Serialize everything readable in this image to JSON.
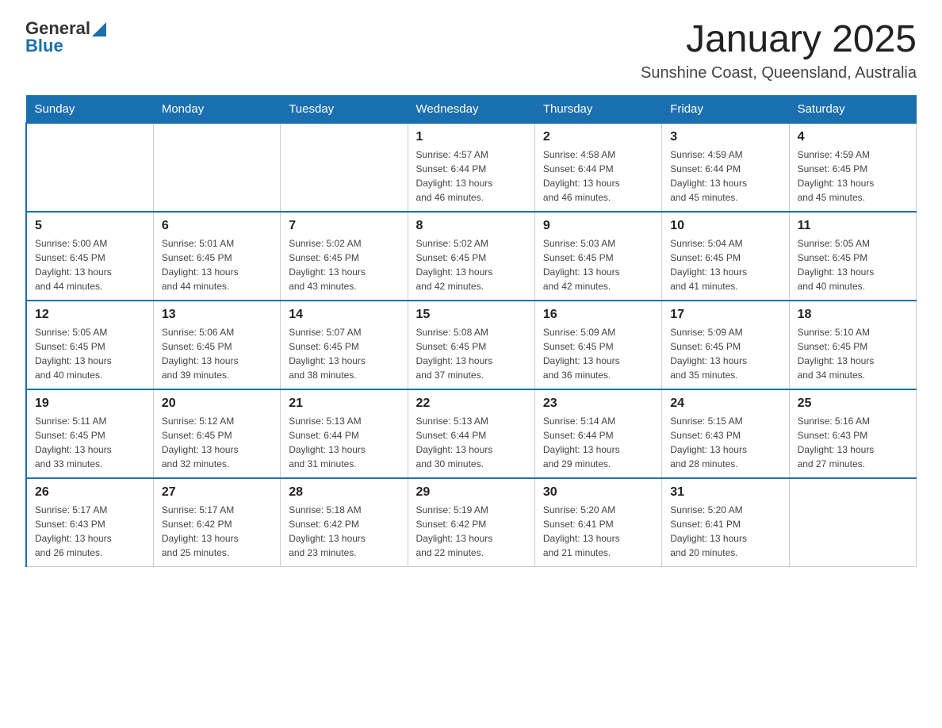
{
  "logo": {
    "text_general": "General",
    "text_blue": "Blue"
  },
  "header": {
    "title": "January 2025",
    "subtitle": "Sunshine Coast, Queensland, Australia"
  },
  "days_of_week": [
    "Sunday",
    "Monday",
    "Tuesday",
    "Wednesday",
    "Thursday",
    "Friday",
    "Saturday"
  ],
  "weeks": [
    [
      {
        "day": "",
        "info": ""
      },
      {
        "day": "",
        "info": ""
      },
      {
        "day": "",
        "info": ""
      },
      {
        "day": "1",
        "info": "Sunrise: 4:57 AM\nSunset: 6:44 PM\nDaylight: 13 hours\nand 46 minutes."
      },
      {
        "day": "2",
        "info": "Sunrise: 4:58 AM\nSunset: 6:44 PM\nDaylight: 13 hours\nand 46 minutes."
      },
      {
        "day": "3",
        "info": "Sunrise: 4:59 AM\nSunset: 6:44 PM\nDaylight: 13 hours\nand 45 minutes."
      },
      {
        "day": "4",
        "info": "Sunrise: 4:59 AM\nSunset: 6:45 PM\nDaylight: 13 hours\nand 45 minutes."
      }
    ],
    [
      {
        "day": "5",
        "info": "Sunrise: 5:00 AM\nSunset: 6:45 PM\nDaylight: 13 hours\nand 44 minutes."
      },
      {
        "day": "6",
        "info": "Sunrise: 5:01 AM\nSunset: 6:45 PM\nDaylight: 13 hours\nand 44 minutes."
      },
      {
        "day": "7",
        "info": "Sunrise: 5:02 AM\nSunset: 6:45 PM\nDaylight: 13 hours\nand 43 minutes."
      },
      {
        "day": "8",
        "info": "Sunrise: 5:02 AM\nSunset: 6:45 PM\nDaylight: 13 hours\nand 42 minutes."
      },
      {
        "day": "9",
        "info": "Sunrise: 5:03 AM\nSunset: 6:45 PM\nDaylight: 13 hours\nand 42 minutes."
      },
      {
        "day": "10",
        "info": "Sunrise: 5:04 AM\nSunset: 6:45 PM\nDaylight: 13 hours\nand 41 minutes."
      },
      {
        "day": "11",
        "info": "Sunrise: 5:05 AM\nSunset: 6:45 PM\nDaylight: 13 hours\nand 40 minutes."
      }
    ],
    [
      {
        "day": "12",
        "info": "Sunrise: 5:05 AM\nSunset: 6:45 PM\nDaylight: 13 hours\nand 40 minutes."
      },
      {
        "day": "13",
        "info": "Sunrise: 5:06 AM\nSunset: 6:45 PM\nDaylight: 13 hours\nand 39 minutes."
      },
      {
        "day": "14",
        "info": "Sunrise: 5:07 AM\nSunset: 6:45 PM\nDaylight: 13 hours\nand 38 minutes."
      },
      {
        "day": "15",
        "info": "Sunrise: 5:08 AM\nSunset: 6:45 PM\nDaylight: 13 hours\nand 37 minutes."
      },
      {
        "day": "16",
        "info": "Sunrise: 5:09 AM\nSunset: 6:45 PM\nDaylight: 13 hours\nand 36 minutes."
      },
      {
        "day": "17",
        "info": "Sunrise: 5:09 AM\nSunset: 6:45 PM\nDaylight: 13 hours\nand 35 minutes."
      },
      {
        "day": "18",
        "info": "Sunrise: 5:10 AM\nSunset: 6:45 PM\nDaylight: 13 hours\nand 34 minutes."
      }
    ],
    [
      {
        "day": "19",
        "info": "Sunrise: 5:11 AM\nSunset: 6:45 PM\nDaylight: 13 hours\nand 33 minutes."
      },
      {
        "day": "20",
        "info": "Sunrise: 5:12 AM\nSunset: 6:45 PM\nDaylight: 13 hours\nand 32 minutes."
      },
      {
        "day": "21",
        "info": "Sunrise: 5:13 AM\nSunset: 6:44 PM\nDaylight: 13 hours\nand 31 minutes."
      },
      {
        "day": "22",
        "info": "Sunrise: 5:13 AM\nSunset: 6:44 PM\nDaylight: 13 hours\nand 30 minutes."
      },
      {
        "day": "23",
        "info": "Sunrise: 5:14 AM\nSunset: 6:44 PM\nDaylight: 13 hours\nand 29 minutes."
      },
      {
        "day": "24",
        "info": "Sunrise: 5:15 AM\nSunset: 6:43 PM\nDaylight: 13 hours\nand 28 minutes."
      },
      {
        "day": "25",
        "info": "Sunrise: 5:16 AM\nSunset: 6:43 PM\nDaylight: 13 hours\nand 27 minutes."
      }
    ],
    [
      {
        "day": "26",
        "info": "Sunrise: 5:17 AM\nSunset: 6:43 PM\nDaylight: 13 hours\nand 26 minutes."
      },
      {
        "day": "27",
        "info": "Sunrise: 5:17 AM\nSunset: 6:42 PM\nDaylight: 13 hours\nand 25 minutes."
      },
      {
        "day": "28",
        "info": "Sunrise: 5:18 AM\nSunset: 6:42 PM\nDaylight: 13 hours\nand 23 minutes."
      },
      {
        "day": "29",
        "info": "Sunrise: 5:19 AM\nSunset: 6:42 PM\nDaylight: 13 hours\nand 22 minutes."
      },
      {
        "day": "30",
        "info": "Sunrise: 5:20 AM\nSunset: 6:41 PM\nDaylight: 13 hours\nand 21 minutes."
      },
      {
        "day": "31",
        "info": "Sunrise: 5:20 AM\nSunset: 6:41 PM\nDaylight: 13 hours\nand 20 minutes."
      },
      {
        "day": "",
        "info": ""
      }
    ]
  ]
}
